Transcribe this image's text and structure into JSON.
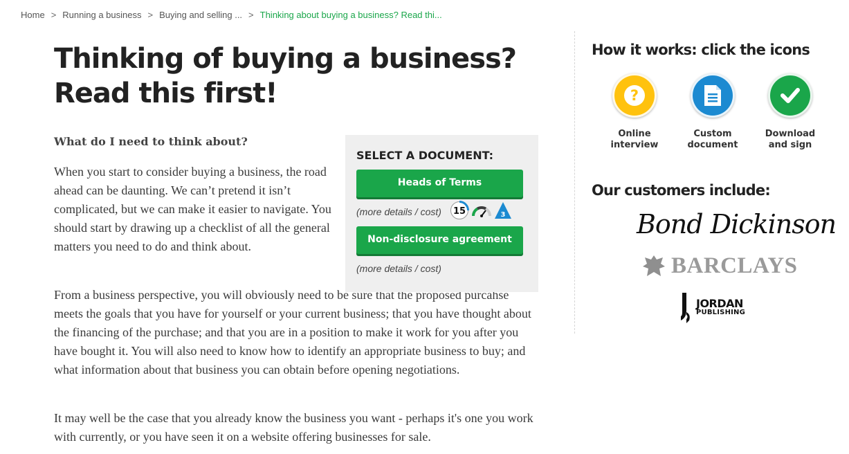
{
  "breadcrumb": {
    "items": [
      "Home",
      "Running a business",
      "Buying and selling ..."
    ],
    "current": "Thinking about buying a business? Read thi...",
    "separator": ">"
  },
  "page_title": "Thinking of buying a business? Read this first!",
  "subheading": "What do I need to think about?",
  "paragraphs": [
    "When you start to consider buying a business, the road ahead can be daunting. We can’t pretend it isn’t complicated, but we can make it easier to navigate. You should start by drawing up a checklist of all the general matters you need to do and think about.",
    "From a business perspective, you will obviously need to be sure that the proposed purcahse meets the goals that you have for yourself or your current business; that you have thought about the financing of the purchase; and that you are in a position to make it work for you after you have bought it. You will also need to know how to identify an appropriate business to buy; and what information about that business you can obtain before opening negotiations.",
    "It may well be the case that you already know the business you want - perhaps it's one you work with currently, or you have seen it on a website offering businesses for sale."
  ],
  "document_box": {
    "title": "SELECT A DOCUMENT:",
    "documents": [
      {
        "label": "Heads of Terms",
        "details": "(more details / cost)",
        "badge_minutes": "15",
        "badge_level": "3"
      },
      {
        "label": "Non-disclosure agreement",
        "details": "(more details / cost)"
      }
    ]
  },
  "how_it_works": {
    "title": "How it works: click the icons",
    "steps": [
      {
        "label_line1": "Online",
        "label_line2": "interview",
        "icon": "question-icon",
        "color": "#ffc20e"
      },
      {
        "label_line1": "Custom",
        "label_line2": "document",
        "icon": "document-icon",
        "color": "#1c8ad1"
      },
      {
        "label_line1": "Download",
        "label_line2": "and sign",
        "icon": "checkmark-icon",
        "color": "#1aa64a"
      }
    ]
  },
  "customers": {
    "title": "Our customers include:",
    "logos": [
      {
        "name": "Bond Dickinson"
      },
      {
        "name": "BARCLAYS"
      },
      {
        "name_line1": "JORDAN",
        "name_line2": "PUBLISHING"
      }
    ]
  },
  "colors": {
    "accent_green": "#1aa64a",
    "box_bg": "#efefef"
  }
}
